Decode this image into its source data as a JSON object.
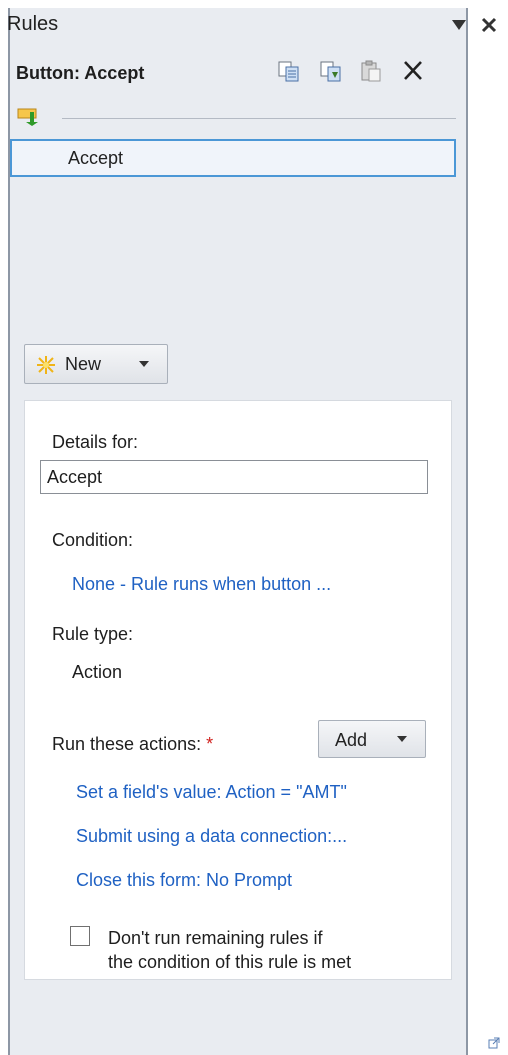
{
  "pane": {
    "title": "Rules",
    "control_label": "Button: Accept",
    "toolbar": {
      "copy_icon": "copy-icon",
      "copy_all_icon": "copy-all-icon",
      "paste_icon": "paste-icon",
      "delete_icon": "delete-icon"
    }
  },
  "rules": [
    {
      "name": "Accept",
      "selected": true
    }
  ],
  "new_button": {
    "label": "New"
  },
  "details": {
    "details_for_label": "Details for:",
    "name_value": "Accept",
    "condition_label": "Condition:",
    "condition_value": "None - Rule runs when button ...",
    "rule_type_label": "Rule type:",
    "rule_type_value": "Action",
    "actions_label": "Run these actions:",
    "required_marker": "*",
    "add_button_label": "Add",
    "actions": [
      "Set a field's value: Action = \"AMT\"",
      "Submit using a data connection:...",
      "Close this form: No Prompt"
    ],
    "stop_rules_checkbox": {
      "checked": false,
      "label_line1": "Don't run remaining rules if",
      "label_line2": "the condition of this rule is met"
    }
  },
  "colors": {
    "pane_bg": "#e9ecf1",
    "link": "#1f61c3",
    "selection_border": "#4b97d6",
    "required": "#d0201d"
  }
}
